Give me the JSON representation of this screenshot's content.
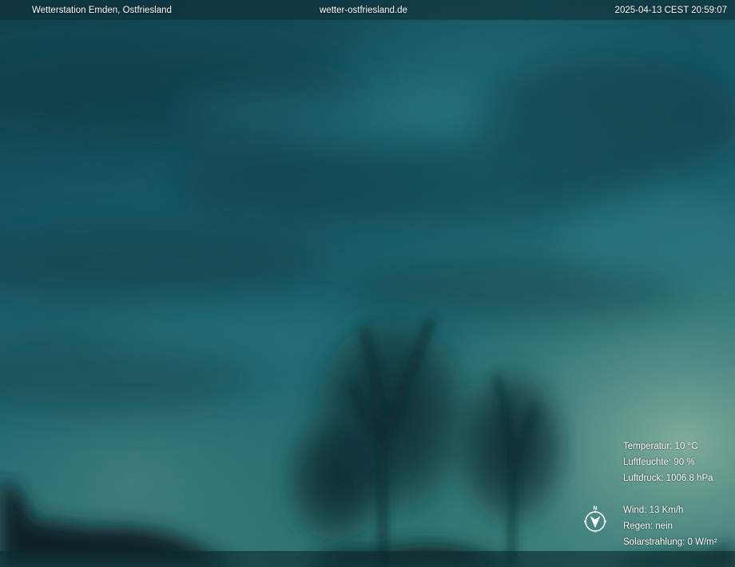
{
  "overlay": {
    "station_name": "Wetterstation Emden, Ostfriesland",
    "website": "wetter-ostfriesland.de",
    "timestamp": "2025-04-13 CEST 20:59:07"
  },
  "readings": {
    "temperature": "Temperatur: 10 °C",
    "humidity": "Luftfeuchte: 90 %",
    "pressure": "Luftdruck: 1006.8 hPa",
    "wind": "Wind: 13 Km/h",
    "rain": "Regen: nein",
    "solar": "Solarstrahlung: 0 W/m²"
  },
  "compass": {
    "north_label": "N",
    "icon": "compass-icon"
  },
  "colors": {
    "sky_dark": "#0d3a44",
    "sky_mid": "#1d6672",
    "horizon_glow": "#5f9a8e",
    "text": "#ffffff"
  }
}
